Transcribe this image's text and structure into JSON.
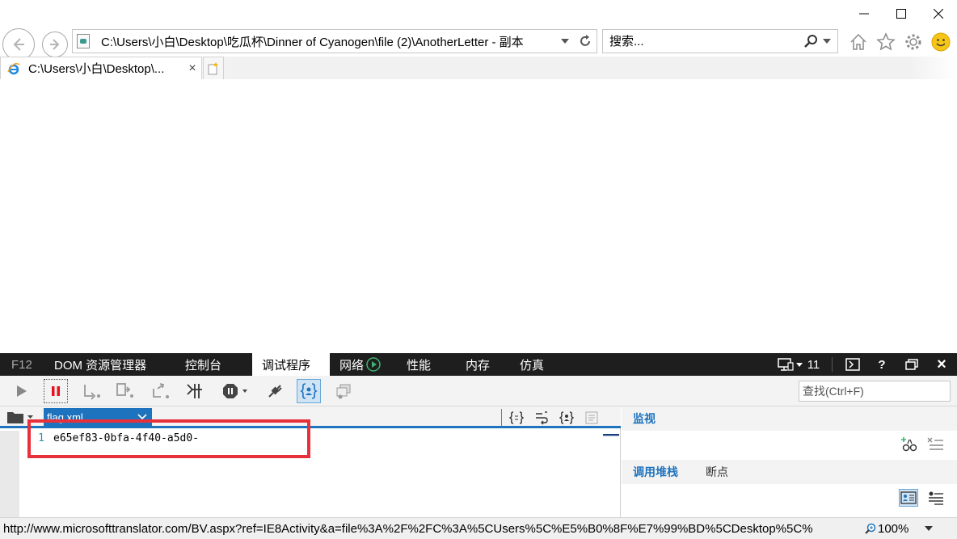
{
  "browser": {
    "address": "C:\\Users\\小白\\Desktop\\吃瓜杯\\Dinner of Cyanogen\\file (2)\\AnotherLetter - 副本",
    "search_placeholder": "搜索...",
    "tab_title": "C:\\Users\\小白\\Desktop\\...",
    "tab_close": "×"
  },
  "devtools": {
    "tabs": [
      {
        "label": "F12"
      },
      {
        "label": "DOM 资源管理器"
      },
      {
        "label": "控制台"
      },
      {
        "label": "调试程序"
      },
      {
        "label": "网络"
      },
      {
        "label": "性能"
      },
      {
        "label": "内存"
      },
      {
        "label": "仿真"
      }
    ],
    "doc_mode": "11",
    "help_label": "?",
    "close_label": "×",
    "find_placeholder": "查找(Ctrl+F)",
    "file_tab": "flag.xml",
    "code": {
      "line_number": "1",
      "text": "e65ef83-0bfa-4f40-a5d0-"
    },
    "watch_title": "监视",
    "callstack_title": "调用堆栈",
    "breakpoints_title": "断点"
  },
  "statusbar": {
    "url": "http://www.microsofttranslator.com/BV.aspx?ref=IE8Activity&a=file%3A%2F%2FC%3A%5CUsers%5C%E5%B0%8F%E7%99%BD%5CDesktop%5C%",
    "zoom": "100%"
  },
  "colors": {
    "accent": "#1e73be",
    "devtools_bar": "#1e1e1e",
    "pause_red": "#e81123",
    "annotation_red": "#e8303a",
    "network_green": "#3cb371"
  }
}
